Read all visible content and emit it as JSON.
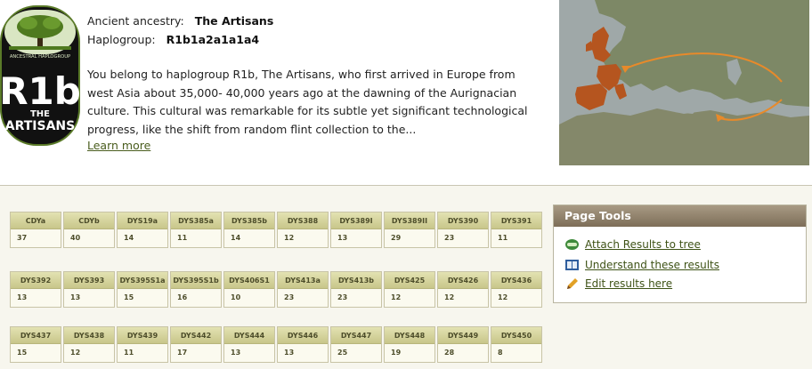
{
  "header": {
    "ancestry_label": "Ancient ancestry:",
    "ancestry_value": "The Artisans",
    "haplogroup_label": "Haplogroup:",
    "haplogroup_value": "R1b1a2a1a1a4",
    "description": "You belong to haplogroup R1b, The Artisans, who first arrived in Europe from west Asia about 35,000- 40,000 years ago at the dawning of the Aurignacian culture. This cultural was remarkable for its subtle yet significant technological progress, like the shift from random flint collection to the...",
    "learn_more": "Learn more"
  },
  "badge": {
    "ring_text": "ANCESTRAL HAPLOGROUP",
    "code": "R1b",
    "line1": "THE",
    "line2": "ARTISANS"
  },
  "markers_rows": [
    [
      {
        "name": "CDYa",
        "value": "37"
      },
      {
        "name": "CDYb",
        "value": "40"
      },
      {
        "name": "DYS19a",
        "value": "14"
      },
      {
        "name": "DYS385a",
        "value": "11"
      },
      {
        "name": "DYS385b",
        "value": "14"
      },
      {
        "name": "DYS388",
        "value": "12"
      },
      {
        "name": "DYS389I",
        "value": "13"
      },
      {
        "name": "DYS389II",
        "value": "29"
      },
      {
        "name": "DYS390",
        "value": "23"
      },
      {
        "name": "DYS391",
        "value": "11"
      }
    ],
    [
      {
        "name": "DYS392",
        "value": "13"
      },
      {
        "name": "DYS393",
        "value": "13"
      },
      {
        "name": "DYS395S1a",
        "value": "15"
      },
      {
        "name": "DYS395S1b",
        "value": "16"
      },
      {
        "name": "DYS406S1",
        "value": "10"
      },
      {
        "name": "DYS413a",
        "value": "23"
      },
      {
        "name": "DYS413b",
        "value": "23"
      },
      {
        "name": "DYS425",
        "value": "12"
      },
      {
        "name": "DYS426",
        "value": "12"
      },
      {
        "name": "DYS436",
        "value": "12"
      }
    ],
    [
      {
        "name": "DYS437",
        "value": "15"
      },
      {
        "name": "DYS438",
        "value": "12"
      },
      {
        "name": "DYS439",
        "value": "11"
      },
      {
        "name": "DYS442",
        "value": "17"
      },
      {
        "name": "DYS444",
        "value": "13"
      },
      {
        "name": "DYS446",
        "value": "13"
      },
      {
        "name": "DYS447",
        "value": "25"
      },
      {
        "name": "DYS448",
        "value": "19"
      },
      {
        "name": "DYS449",
        "value": "28"
      },
      {
        "name": "DYS450",
        "value": "8"
      }
    ]
  ],
  "page_tools": {
    "title": "Page Tools",
    "items": [
      {
        "label": "Attach Results to tree",
        "icon": "tree-link-icon"
      },
      {
        "label": "Understand these results",
        "icon": "book-icon"
      },
      {
        "label": "Edit results here",
        "icon": "pencil-icon"
      }
    ]
  },
  "colors": {
    "badge_bg": "#111111",
    "badge_ring": "#5a7a28",
    "link": "#3e5216",
    "marker_header": "#d6d49c",
    "tools_header": "#8e806a",
    "map_highlight": "#b5551f",
    "migration_arrow": "#e88a2a"
  }
}
